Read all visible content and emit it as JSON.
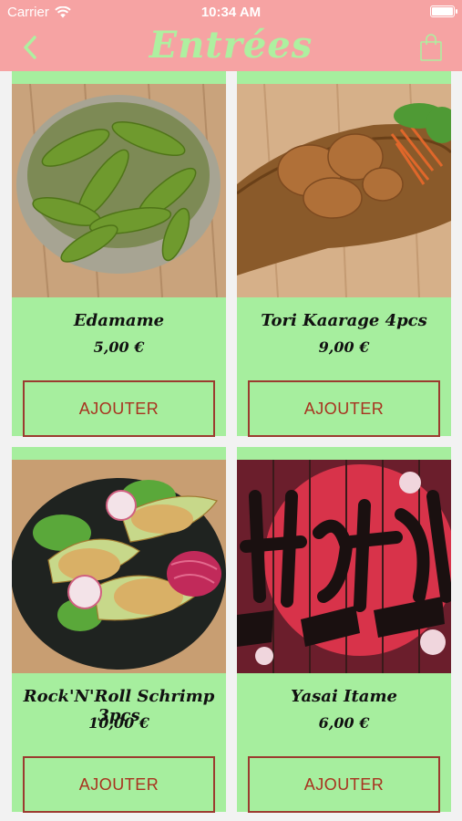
{
  "status": {
    "carrier": "Carrier",
    "time": "10:34 AM"
  },
  "nav": {
    "title": "Entrées",
    "icons": {
      "back": "chevron-left-icon",
      "cart": "shopping-bag-icon"
    }
  },
  "colors": {
    "header": "#f6a3a3",
    "title": "#aef0a0",
    "card": "#a6ee9e",
    "button_border": "#9b3b2f",
    "button_text": "#a8321f"
  },
  "products": [
    {
      "name": "Edamame",
      "price": "5,00 €",
      "button": "AJOUTER",
      "image": "edamame-bowl"
    },
    {
      "name": "Tori Kaarage 4pcs",
      "price": "9,00 €",
      "button": "AJOUTER",
      "image": "fried-chicken-board"
    },
    {
      "name": "Rock'N'Roll Schrimp 3pcs",
      "price": "10,00 €",
      "button": "AJOUTER",
      "image": "fried-shrimp-salad"
    },
    {
      "name": "Yasai Itame",
      "price": "6,00 €",
      "button": "AJOUTER",
      "image": "graffiti-wall"
    }
  ]
}
